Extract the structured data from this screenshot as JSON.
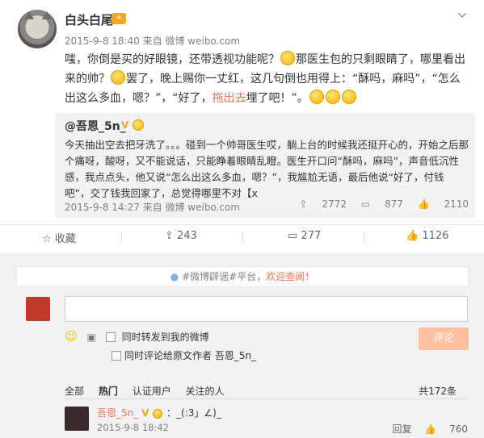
{
  "post": {
    "author": "白头白尾",
    "author_badge": "☀",
    "meta": "2015-9-8 18:40 来自 微博 weibo.com",
    "text_parts": {
      "p1": "嗤，你倒是买的好眼镜，还带透视功能呢？",
      "p2": "那医生包的只剩眼睛了，哪里看出来的帅？",
      "p3": "罢了，晚上赐你一丈红，这几句倒也用得上：“酥吗，麻吗”，“怎么出这么多血，嗯？”，“好了，",
      "p4_red": "拖出去",
      "p5": "埋了吧！”。"
    }
  },
  "quote": {
    "nick": "@吾恩_5n_",
    "badge_v": "V",
    "text": "今天抽出空去把牙洗了。。。碰到一个帅哥医生哎，躺上台的时候我还挺开心的，开始之后那个痛呀，酸呀，又不能说话，只能睁着眼睛乱瞪。医生开口问“酥吗，麻吗”，声音低沉性感，我点点头，他又说“怎么出这么多血，嗯？”，我尴尬无语，最后他说“好了，付钱吧”，交了钱我回家了，总觉得哪里不对【x",
    "meta": "2015-9-8 14:27 来自 微博 weibo.com",
    "reposts": "2772",
    "comments": "877",
    "likes": "2110"
  },
  "actions": {
    "favorite": "收藏",
    "repost": "243",
    "comment": "277",
    "like": "1126"
  },
  "comment_box": {
    "notice_prefix": "#微博辟谣#平台，",
    "notice_highlight": "欢迎查阅！",
    "checkbox1": "同时转发到我的微博",
    "checkbox2": "同时评论给原文作者 吾恩_5n_",
    "submit": "评论"
  },
  "tabs": {
    "all": "全部",
    "hot": "热门",
    "verified": "认证用户",
    "follow": "关注的人",
    "total": "共172条"
  },
  "reply": {
    "nick": "吾恩_5n_",
    "badge_v": "V",
    "text": "：_(:3」∠)_",
    "time": "2015-9-8 18:42",
    "reply_label": "回复",
    "likes": "760"
  },
  "colors": {
    "accent": "#eb7350",
    "submit_bg": "#ffc09f",
    "badge": "#f5a623",
    "quote_bg": "#f2f2f5"
  }
}
